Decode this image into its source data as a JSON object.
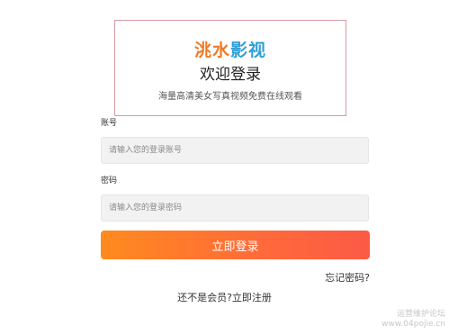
{
  "brand": {
    "part1": "洮水",
    "part2": "影视"
  },
  "header": {
    "welcome": "欢迎登录",
    "subtitle": "海量高清美女写真视频免费在线观看"
  },
  "form": {
    "account_label": "账号",
    "account_placeholder": "请输入您的登录账号",
    "password_label": "密码",
    "password_placeholder": "请输入您的登录密码",
    "submit_label": "立即登录"
  },
  "links": {
    "forgot": "忘记密码?",
    "not_member": "还不是会员?",
    "register": "立即注册"
  },
  "watermark": {
    "line1": "运营维护论坛",
    "line2": "www.04pojie.cn"
  },
  "colors": {
    "brand_orange": "#f07a24",
    "brand_blue": "#2f9fd6",
    "button_start": "#ff8a1e",
    "button_end": "#fb5a45",
    "header_border": "#d79aa2"
  }
}
